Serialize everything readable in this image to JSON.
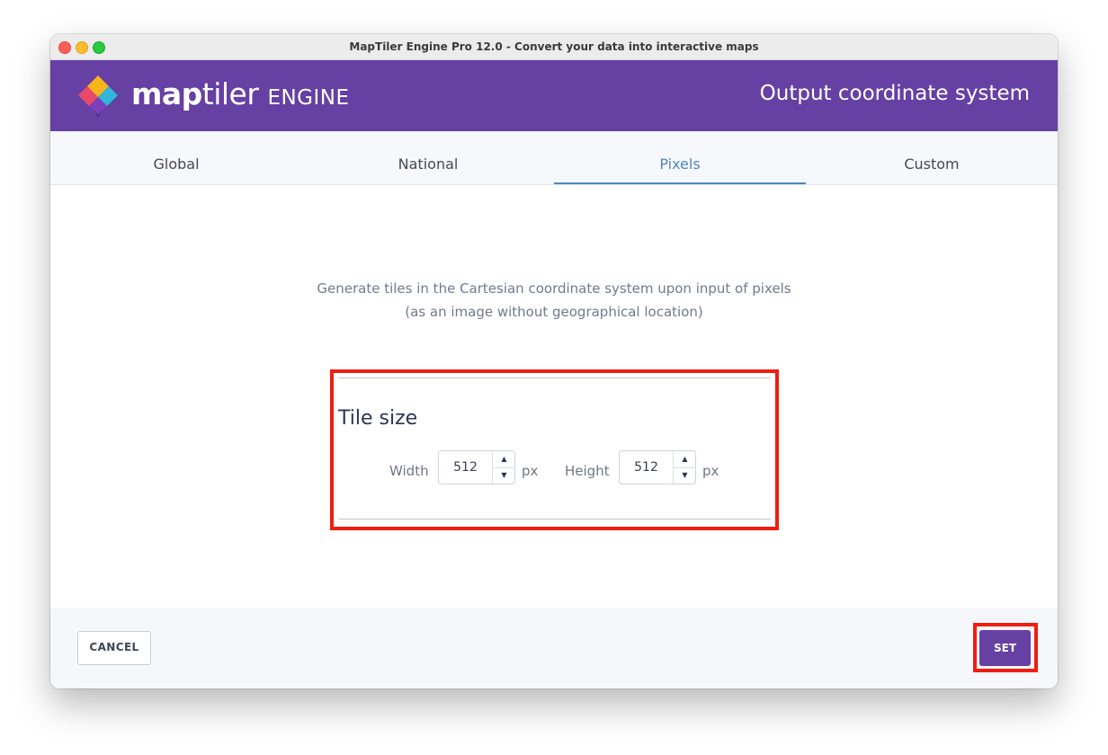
{
  "window": {
    "title": "MapTiler Engine Pro 12.0 - Convert your data into interactive maps"
  },
  "header": {
    "brand_map": "map",
    "brand_tiler": "tiler",
    "brand_engine": "ENGINE",
    "title": "Output coordinate system"
  },
  "tabs": [
    {
      "label": "Global",
      "active": false
    },
    {
      "label": "National",
      "active": false
    },
    {
      "label": "Pixels",
      "active": true
    },
    {
      "label": "Custom",
      "active": false
    }
  ],
  "content": {
    "description_line1": "Generate tiles in the Cartesian coordinate system upon input of pixels",
    "description_line2": "(as an image without geographical location)",
    "tile_size": {
      "title": "Tile size",
      "width_label": "Width",
      "width_value": "512",
      "height_label": "Height",
      "height_value": "512",
      "unit": "px"
    }
  },
  "footer": {
    "cancel_label": "CANCEL",
    "set_label": "SET"
  },
  "colors": {
    "brand_purple": "#6640a3",
    "active_tab": "#4d86c6",
    "highlight_red": "#f01d10"
  },
  "icons": {
    "logo": "maptiler-logo-icon",
    "spin_up": "arrow-up-icon",
    "spin_down": "arrow-down-icon"
  }
}
